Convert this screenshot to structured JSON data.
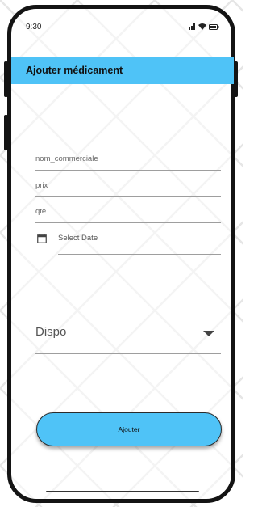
{
  "status_bar": {
    "time": "9:30",
    "icons": [
      "signal-icon",
      "wifi-icon",
      "battery-icon"
    ]
  },
  "app_bar": {
    "title": "Ajouter médicament",
    "color": "#4fc3f7"
  },
  "form": {
    "fields": [
      {
        "placeholder": "nom_commerciale"
      },
      {
        "placeholder": "prix"
      },
      {
        "placeholder": "qte"
      }
    ],
    "date": {
      "label": "Select Date",
      "icon": "calendar-icon"
    },
    "dropdown": {
      "selected": "Dispo",
      "icon": "dropdown-arrow-icon"
    },
    "submit_label": "Ajouter"
  }
}
